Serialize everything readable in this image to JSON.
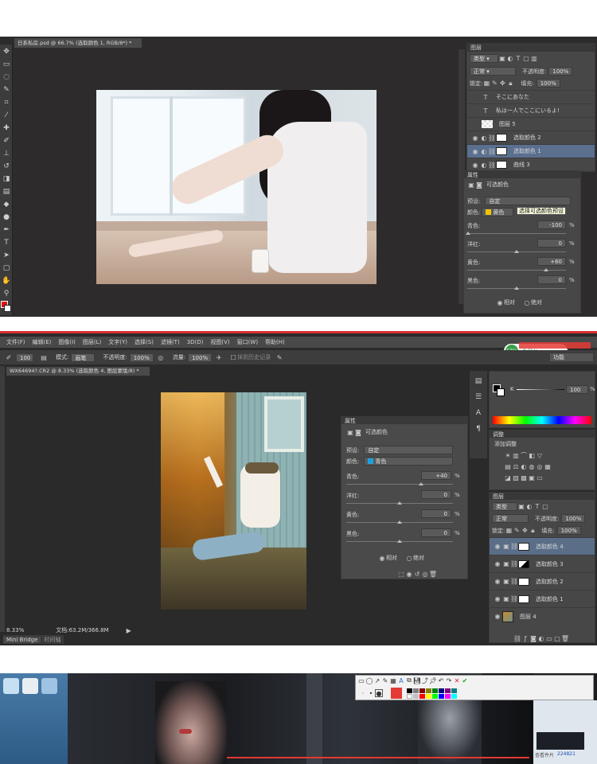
{
  "s1": {
    "doc_tab": "日系私房.psd @ 66.7% (选取颜色 1, RGB/8*) *",
    "layers_title": "图层",
    "layers_filter": "类型",
    "blend_mode": "正常",
    "opacity_label": "不透明度:",
    "opacity_value": "100%",
    "lock_label": "锁定:",
    "fill_label": "填充:",
    "fill_value": "100%",
    "layers": [
      {
        "name": "そこにあなた",
        "kind": "T"
      },
      {
        "name": "私は一人でここにいるよ!",
        "kind": "T"
      },
      {
        "name": "图层 5",
        "kind": "img"
      },
      {
        "name": "选取颜色 2",
        "kind": "adj"
      },
      {
        "name": "选取颜色 1",
        "kind": "adj"
      },
      {
        "name": "曲线 3",
        "kind": "adj"
      }
    ],
    "props_title": "属性",
    "props_header": "可选颜色",
    "preset_label": "预设:",
    "preset_value": "自定",
    "tooltip": "选择可选颜色预设",
    "color_label": "颜色:",
    "color_value": "黄色",
    "sliders": [
      {
        "label": "青色:",
        "value": "-100",
        "unit": "%"
      },
      {
        "label": "洋红:",
        "value": "0",
        "unit": "%"
      },
      {
        "label": "黄色:",
        "value": "+60",
        "unit": "%"
      },
      {
        "label": "黑色:",
        "value": "0",
        "unit": "%"
      }
    ],
    "radio_relative": "相对",
    "radio_absolute": "绝对"
  },
  "s2": {
    "menus": [
      "文件(F)",
      "编辑(E)",
      "图像(I)",
      "图层(L)",
      "文字(Y)",
      "选择(S)",
      "滤镜(T)",
      "3D(D)",
      "视图(V)",
      "窗口(W)",
      "帮助(H)"
    ],
    "opt_size": "100",
    "opt_mode_label": "模式:",
    "opt_mode": "画笔",
    "opt_opacity_label": "不透明度:",
    "opt_opacity": "100%",
    "opt_flow_label": "流量:",
    "opt_flow": "100%",
    "opt_erase": "抹到历史记录",
    "doc_tab": "WX64694?.CR2 @ 8.33% (选取颜色 4, 图层蒙版/8) *",
    "zoom": "8.33%",
    "docsize": "文档:63.2M/366.8M",
    "bottom_tab1": "Mini Bridge",
    "bottom_tab2": "时间轴",
    "props_title": "属性",
    "props_header": "可选颜色",
    "preset_label": "预设:",
    "preset_value": "自定",
    "color_label": "颜色:",
    "color_value": "青色",
    "sliders": [
      {
        "label": "青色:",
        "value": "+40",
        "unit": "%"
      },
      {
        "label": "洋红:",
        "value": "0",
        "unit": "%"
      },
      {
        "label": "黄色:",
        "value": "0",
        "unit": "%"
      },
      {
        "label": "黑色:",
        "value": "0",
        "unit": "%"
      }
    ],
    "radio_relative": "相对",
    "radio_absolute": "绝对",
    "essentials": "功能",
    "net_percent": "57%",
    "net_speed": "0.6k/s",
    "color_k": "K",
    "color_k_value": "100",
    "adjust_title": "调整",
    "adjust_sub": "添加调整",
    "layers_title": "图层",
    "layers_filter": "类型",
    "blend_mode": "正常",
    "opacity_label": "不透明度:",
    "opacity_value": "100%",
    "lock_label": "锁定:",
    "fill_label": "填充:",
    "fill_value": "100%",
    "layers": [
      {
        "name": "选取颜色 4",
        "mask": "white"
      },
      {
        "name": "选取颜色 3",
        "mask": "black"
      },
      {
        "name": "选取颜色 2",
        "mask": "white"
      },
      {
        "name": "选取颜色 1",
        "mask": "white"
      },
      {
        "name": "图层 4",
        "mask": "photo"
      }
    ]
  },
  "s3": {
    "side_caption": "查看件片",
    "side_number": "224821"
  },
  "colors": {
    "ps_bg": "#2b2b2b",
    "panel": "#474747",
    "selected": "#5b6f8f",
    "accent_red": "#e53935",
    "accent_green": "#3aa04a",
    "blue_swatch": "#1ea0e0",
    "yellow_swatch": "#f2c200"
  }
}
